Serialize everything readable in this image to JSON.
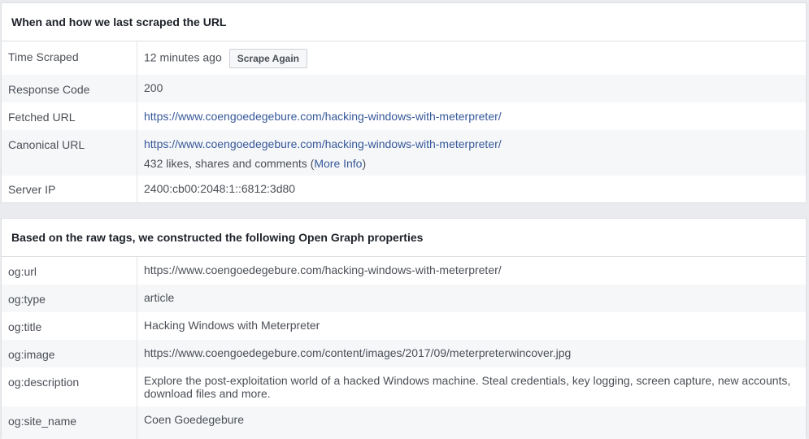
{
  "scrape": {
    "heading": "When and how we last scraped the URL",
    "time_scraped": {
      "label": "Time Scraped",
      "value": "12 minutes ago",
      "button": "Scrape Again"
    },
    "response_code": {
      "label": "Response Code",
      "value": "200"
    },
    "fetched_url": {
      "label": "Fetched URL",
      "value": "https://www.coengoedegebure.com/hacking-windows-with-meterpreter/"
    },
    "canonical_url": {
      "label": "Canonical URL",
      "value": "https://www.coengoedegebure.com/hacking-windows-with-meterpreter/",
      "engagement_text": "432 likes, shares and comments (",
      "more_info": "More Info",
      "close_paren": ")"
    },
    "server_ip": {
      "label": "Server IP",
      "value": "2400:cb00:2048:1::6812:3d80"
    }
  },
  "og": {
    "heading": "Based on the raw tags, we constructed the following Open Graph properties",
    "rows": [
      {
        "key": "og:url",
        "value": "https://www.coengoedegebure.com/hacking-windows-with-meterpreter/"
      },
      {
        "key": "og:type",
        "value": "article"
      },
      {
        "key": "og:title",
        "value": "Hacking Windows with Meterpreter"
      },
      {
        "key": "og:image",
        "value": "https://www.coengoedegebure.com/content/images/2017/09/meterpreterwincover.jpg"
      },
      {
        "key": "og:description",
        "value": "Explore the post-exploitation world of a hacked Windows machine. Steal credentials, key logging, screen capture, new accounts, download files and more."
      },
      {
        "key": "og:site_name",
        "value": "Coen Goedegebure"
      }
    ]
  },
  "colors": {
    "link": "#365899",
    "text": "#4b4f56",
    "alt_row": "#f6f7f9",
    "page_bg": "#e9ebee"
  }
}
